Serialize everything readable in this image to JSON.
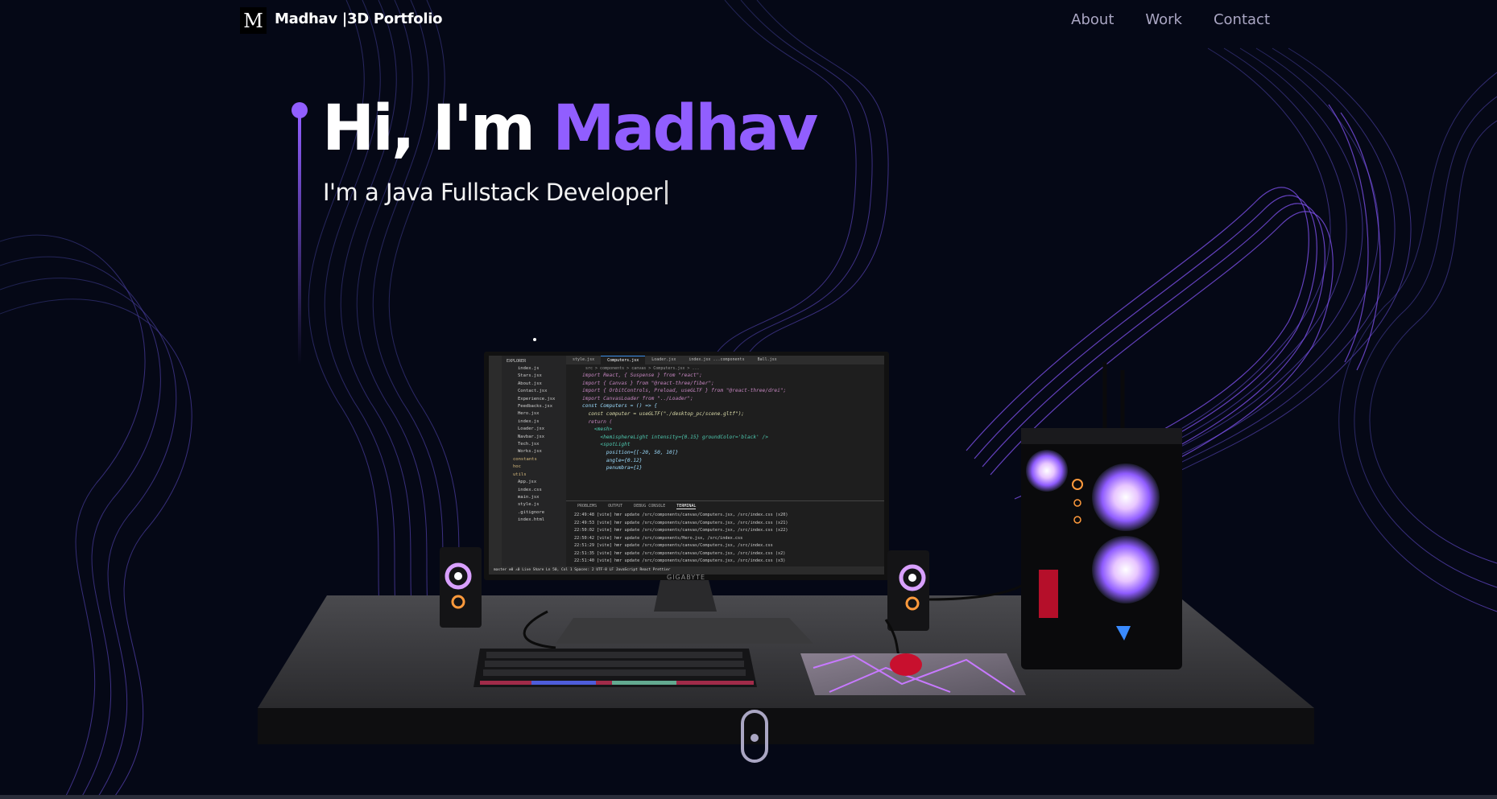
{
  "nav": {
    "logo_letter": "M",
    "brand": "Madhav |3D Portfolio",
    "links": [
      "About",
      "Work",
      "Contact"
    ]
  },
  "hero": {
    "greeting": "Hi, I'm ",
    "name": "Madhav",
    "subtitle": "I'm a Java Fullstack Developer"
  },
  "monitor": {
    "brand": "GIGABYTE",
    "editor": {
      "tabs": [
        "style.jsx",
        "Computers.jsx",
        "Loader.jsx",
        "index.jsx ...components",
        "Ball.jsx"
      ],
      "breadcrumb": "src > components > canvas > Computers.jsx > ...",
      "explorer_header": "EXPLORER",
      "files": [
        "index.js",
        "Stars.jsx",
        "About.jsx",
        "Contact.jsx",
        "Experience.jsx",
        "Feedbacks.jsx",
        "Hero.jsx",
        "index.js",
        "Loader.jsx",
        "Navbar.jsx",
        "Tech.jsx",
        "Works.jsx",
        "constants",
        "hoc",
        "utils",
        "App.jsx",
        "index.css",
        "main.jsx",
        "style.js",
        ".gitignore",
        "index.html"
      ],
      "code": [
        "import React, { Suspense } from \"react\";",
        "import { Canvas } from \"@react-three/fiber\";",
        "import { OrbitControls, Preload, useGLTF } from \"@react-three/drei\";",
        "",
        "import CanvasLoader from \"../Loader\";",
        "",
        "const Computers = () => {",
        "  const computer = useGLTF(\"./desktop_pc/scene.gltf\");",
        "",
        "  return (",
        "    <mesh>",
        "      <hemisphereLight intensity={0.15} groundColor='black' />",
        "      <spotLight",
        "        position={[-20, 50, 10]}",
        "        angle={0.12}",
        "        penumbra={1}"
      ],
      "panel_tabs": [
        "PROBLEMS",
        "OUTPUT",
        "DEBUG CONSOLE",
        "TERMINAL"
      ],
      "terminal": [
        "22:49:48 [vite] hmr update /src/components/canvas/Computers.jsx, /src/index.css (x20)",
        "22:49:53 [vite] hmr update /src/components/canvas/Computers.jsx, /src/index.css (x21)",
        "22:50:02 [vite] hmr update /src/components/canvas/Computers.jsx, /src/index.css (x22)",
        "22:50:42 [vite] hmr update /src/components/Hero.jsx, /src/index.css",
        "22:51:29 [vite] hmr update /src/components/canvas/Computers.jsx, /src/index.css",
        "22:51:35 [vite] hmr update /src/components/canvas/Computers.jsx, /src/index.css (x2)",
        "22:51:40 [vite] hmr update /src/components/canvas/Computers.jsx, /src/index.css (x3)"
      ],
      "statusbar": "master  ⊗0 ⚠0  Live Share      Ln 50, Col 1  Spaces: 2  UTF-8  LF  JavaScript React  Prettier"
    }
  },
  "colors": {
    "background": "#050816",
    "accent": "#915eff",
    "nav_link": "#aaa6c3",
    "text": "#ffffff"
  },
  "icons": [
    "logo-m-icon",
    "scroll-mouse-icon"
  ]
}
